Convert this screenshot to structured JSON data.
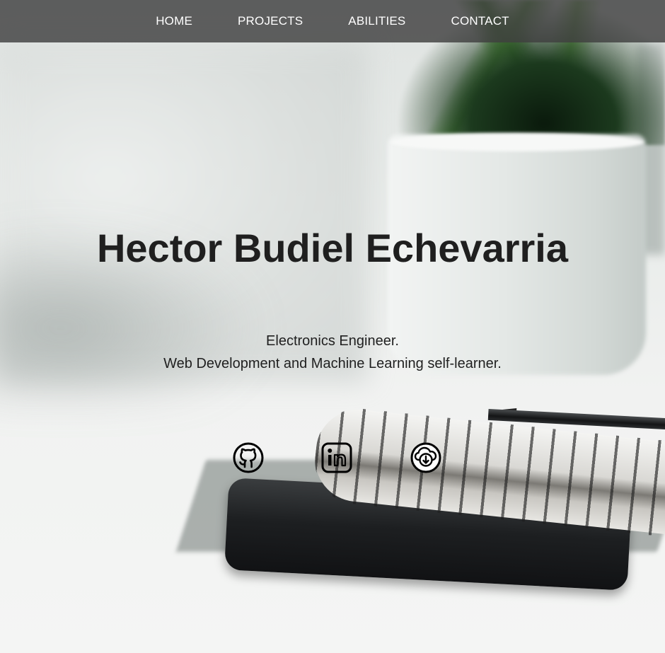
{
  "nav": {
    "items": [
      {
        "label": "HOME"
      },
      {
        "label": "PROJECTS"
      },
      {
        "label": "ABILITIES"
      },
      {
        "label": "CONTACT"
      }
    ]
  },
  "hero": {
    "name": "Hector Budiel Echevarria",
    "tagline_line1": "Electronics Engineer.",
    "tagline_line2": "Web Development and Machine Learning self-learner."
  },
  "social": {
    "icons": [
      "github-icon",
      "linkedin-icon",
      "download-cv-icon"
    ]
  },
  "colors": {
    "nav_background": "#404040",
    "nav_text": "#ffffff",
    "heading_text": "#1f1f1f"
  }
}
